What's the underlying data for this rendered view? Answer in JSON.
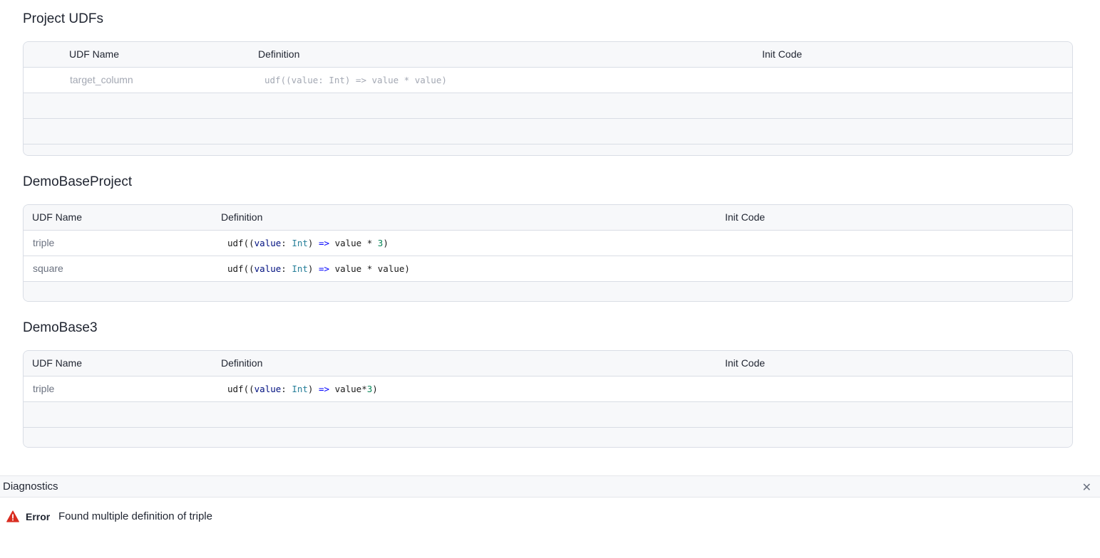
{
  "project_udfs": {
    "title": "Project UDFs",
    "headers": {
      "name": "UDF Name",
      "definition": "Definition",
      "init_code": "Init Code"
    },
    "placeholder": {
      "name": "target_column",
      "definition": "udf((value: Int) => value * value)"
    }
  },
  "demo_base_project": {
    "title": "DemoBaseProject",
    "headers": {
      "name": "UDF Name",
      "definition": "Definition",
      "init_code": "Init Code"
    },
    "rows": [
      {
        "name": "triple",
        "definition": "udf((value: Int) => value * 3)"
      },
      {
        "name": "square",
        "definition": "udf((value: Int) => value * value)"
      }
    ]
  },
  "demo_base3": {
    "title": "DemoBase3",
    "headers": {
      "name": "UDF Name",
      "definition": "Definition",
      "init_code": "Init Code"
    },
    "rows": [
      {
        "name": "triple",
        "definition": "udf((value: Int) => value*3)"
      }
    ]
  },
  "diagnostics": {
    "title": "Diagnostics",
    "close_icon": "close-icon",
    "items": [
      {
        "severity": "Error",
        "message": "Found multiple definition of triple",
        "icon": "warning-triangle-icon",
        "color": "#d92d20"
      }
    ]
  },
  "colors": {
    "border": "#d9dde5",
    "header_bg": "#f7f8fa",
    "placeholder_text": "#a3a8b3"
  }
}
